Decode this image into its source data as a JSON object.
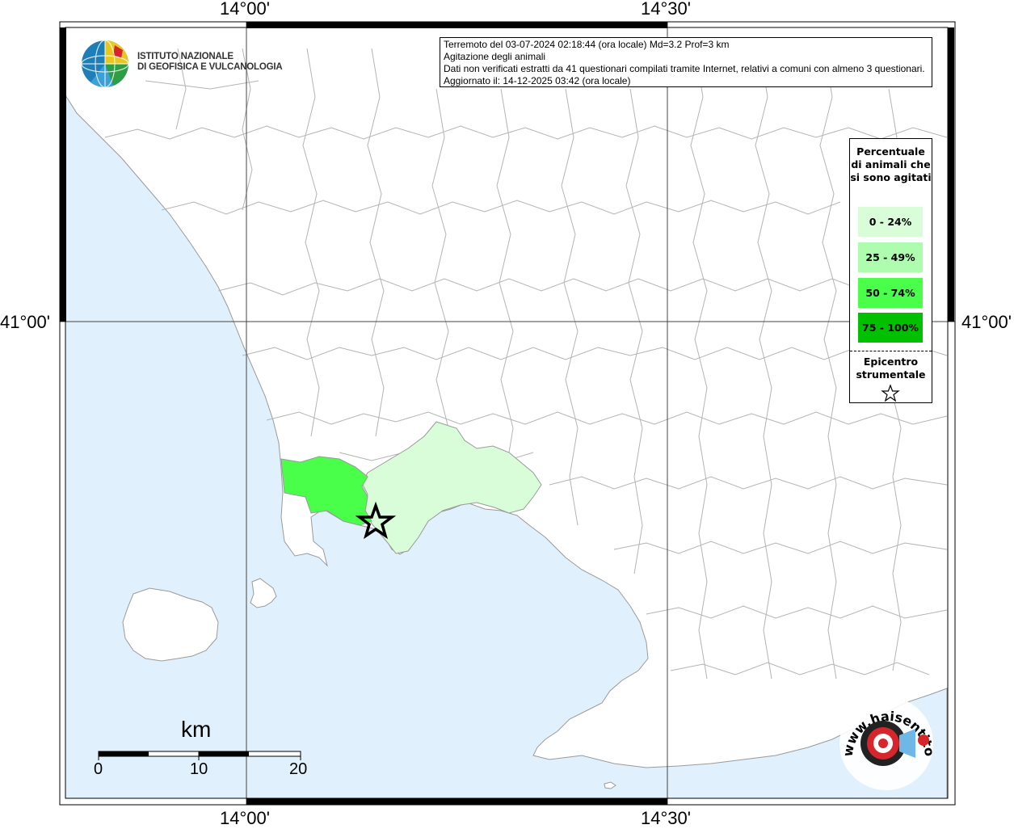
{
  "map": {
    "top_lon_labels": [
      "14°00'",
      "14°30'"
    ],
    "bottom_lon_labels": [
      "14°00'",
      "14°30'"
    ],
    "lat_label_left": "41°00'",
    "lat_label_right": "41°00'"
  },
  "info": {
    "line1": "Terremoto del 03-07-2024 02:18:44 (ora locale) Md=3.2 Prof=3 km",
    "line2": "Agitazione degli animali",
    "line3": "Dati non verificati estratti da 41 questionari compilati tramite Internet, relativi a comuni con almeno 3 questionari.",
    "line4": "Aggiornato il: 14-12-2025 03:42 (ora locale)"
  },
  "legend": {
    "title": "Percentuale di animali che si sono agitati",
    "classes": [
      {
        "label": "0 - 24%",
        "color": "#d9fdd9"
      },
      {
        "label": "25 - 49%",
        "color": "#aefcae"
      },
      {
        "label": "50 - 74%",
        "color": "#49ff49"
      },
      {
        "label": "75 - 100%",
        "color": "#00c000"
      }
    ],
    "epicenter_label": "Epicentro strumentale"
  },
  "ingv": {
    "line1": "ISTITUTO NAZIONALE",
    "line2": "DI GEOFISICA E VULCANOLOGIA"
  },
  "scale": {
    "unit": "km",
    "ticks": [
      "0",
      "10",
      "20"
    ]
  },
  "hsit_logo_text": "www.haisentitoilterremoto.it",
  "colors": {
    "sea": "#e0f1fd",
    "land": "#ffffff",
    "border": "#b4b4b4",
    "class_0_24": "#d9fdd9",
    "class_50_74": "#49ff49"
  }
}
